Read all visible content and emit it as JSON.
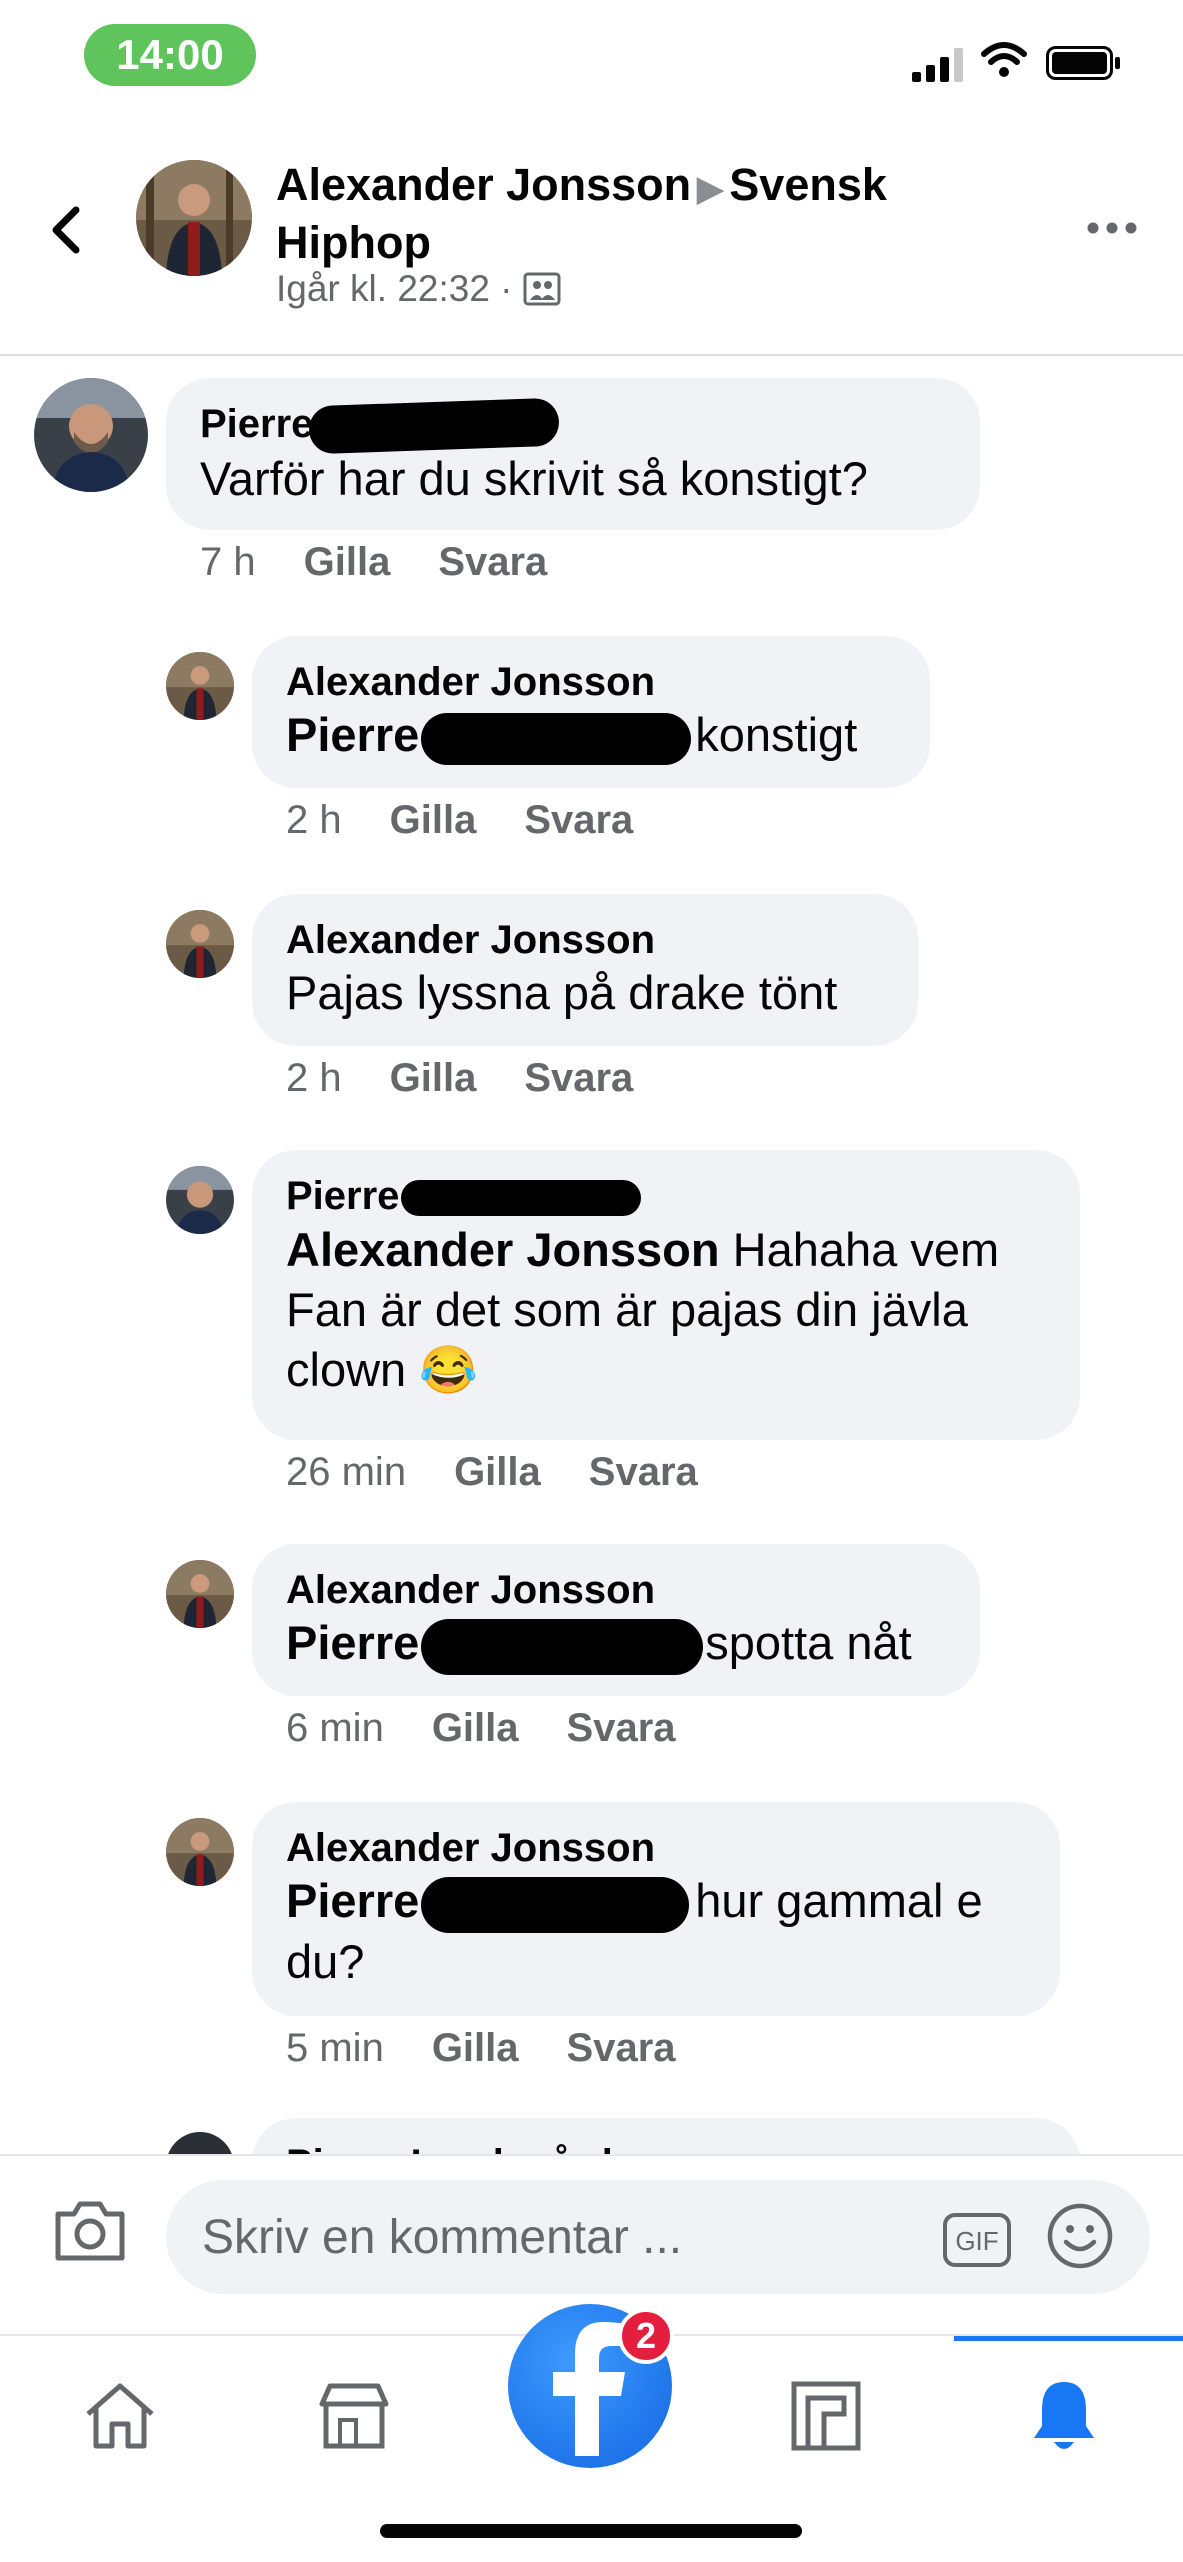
{
  "status_bar": {
    "time": "14:00"
  },
  "header": {
    "author": "Alexander Jonsson",
    "group": "Svensk Hiphop",
    "timestamp": "Igår kl. 22:32 ·"
  },
  "comments": [
    {
      "author": "Pierre",
      "text": "Varför har du skrivit så konstigt?",
      "time": "7 h",
      "like": "Gilla",
      "reply": "Svara"
    },
    {
      "author": "Alexander Jonsson",
      "mention": "Pierre",
      "text": "konstigt",
      "time": "2 h",
      "like": "Gilla",
      "reply": "Svara"
    },
    {
      "author": "Alexander Jonsson",
      "text": "Pajas lyssna på drake tönt",
      "time": "2 h",
      "like": "Gilla",
      "reply": "Svara"
    },
    {
      "author": "Pierre",
      "mention": "Alexander Jonsson",
      "text": "Hahaha vem Fan är det som är pajas din jävla clown 😂",
      "time": "26 min",
      "like": "Gilla",
      "reply": "Svara"
    },
    {
      "author": "Alexander Jonsson",
      "mention": "Pierre",
      "text": "spotta nåt",
      "time": "6 min",
      "like": "Gilla",
      "reply": "Svara"
    },
    {
      "author": "Alexander Jonsson",
      "mention": "Pierre",
      "text": "hur gammal e du?",
      "time": "5 min",
      "like": "Gilla",
      "reply": "Svara"
    },
    {
      "author": "Pierre Ingelegård"
    }
  ],
  "composer": {
    "placeholder": "Skriv en kommentar ...",
    "gif_label": "GIF"
  },
  "tabbar": {
    "items": [
      "home-icon",
      "marketplace-icon",
      "facebook-logo",
      "pages-icon",
      "notifications-bell-icon"
    ],
    "badge": "2",
    "active": "notifications"
  },
  "colors": {
    "accent": "#1877f2",
    "bubble": "#f0f2f5",
    "badge": "#e41e3f",
    "time_pill": "#5fc45c"
  }
}
